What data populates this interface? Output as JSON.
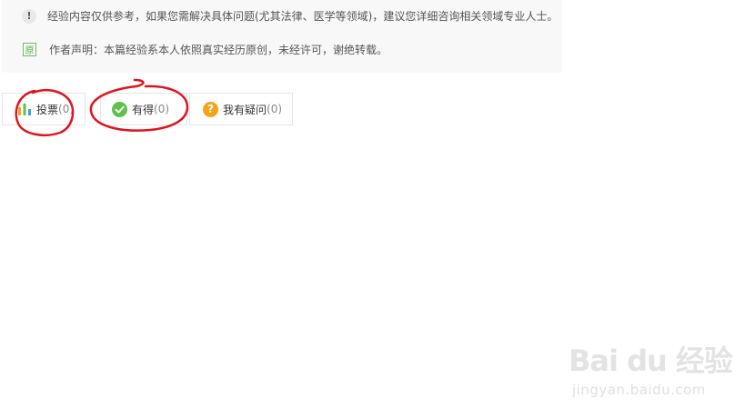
{
  "notice": {
    "disclaimer_icon_glyph": "!",
    "disclaimer": "经验内容仅供参考，如果您需解决具体问题(尤其法律、医学等领域)，建议您详细咨询相关领域专业人士。",
    "original_icon_label": "原",
    "author_statement": "作者声明：本篇经验系本人依照真实经历原创，未经许可，谢绝转载。"
  },
  "actions": {
    "vote": {
      "label": "投票",
      "count": "(0)",
      "icon": "bar-chart-icon"
    },
    "got": {
      "label": "有得",
      "count": "(0)",
      "icon": "check-circle-icon"
    },
    "ask": {
      "label": "我有疑问",
      "count": "(0)",
      "icon": "question-circle-icon",
      "icon_glyph": "?"
    }
  },
  "watermark": {
    "brand": "Bai du 经验",
    "url": "jingyan.baidu.com"
  },
  "colors": {
    "check_green": "#5cc24a",
    "question_orange": "#f5a21b",
    "annotation_red": "#e0141e"
  }
}
